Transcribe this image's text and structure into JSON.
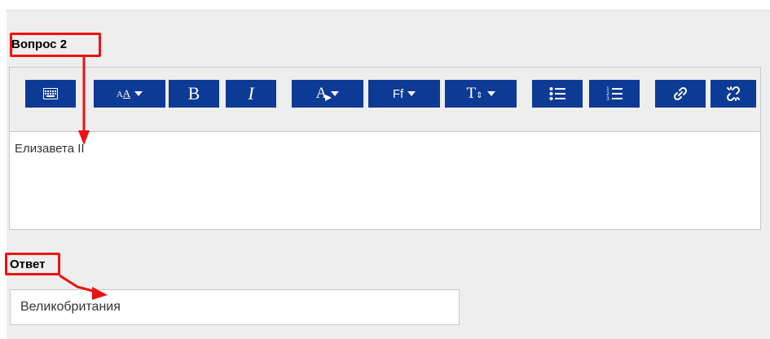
{
  "question": {
    "label": "Вопрос 2",
    "content": "Елизавета II"
  },
  "toolbar": {
    "buttons": [
      {
        "name": "toolbar-toggle",
        "icon": "keyboard-icon"
      },
      {
        "name": "paragraph-styles",
        "text": "A͟A",
        "icon": "paragraph-styles-icon"
      },
      {
        "name": "bold",
        "text": "B",
        "icon": "bold-icon"
      },
      {
        "name": "italic",
        "text": "I",
        "icon": "italic-icon"
      },
      {
        "name": "font-color",
        "text": "A",
        "icon": "font-color-icon"
      },
      {
        "name": "font-family",
        "text": "Ff",
        "icon": "font-family-icon"
      },
      {
        "name": "font-size",
        "text": "T",
        "icon": "font-size-icon"
      },
      {
        "name": "unordered-list",
        "icon": "bullet-list-icon"
      },
      {
        "name": "ordered-list",
        "icon": "numbered-list-icon"
      },
      {
        "name": "link",
        "icon": "link-icon"
      },
      {
        "name": "unlink",
        "icon": "unlink-icon"
      }
    ]
  },
  "answer": {
    "label": "Ответ",
    "value": "Великобритания"
  },
  "colors": {
    "toolbar_button": "#0d3a94",
    "highlight": "#ee1111",
    "panel": "#eeeeee"
  }
}
